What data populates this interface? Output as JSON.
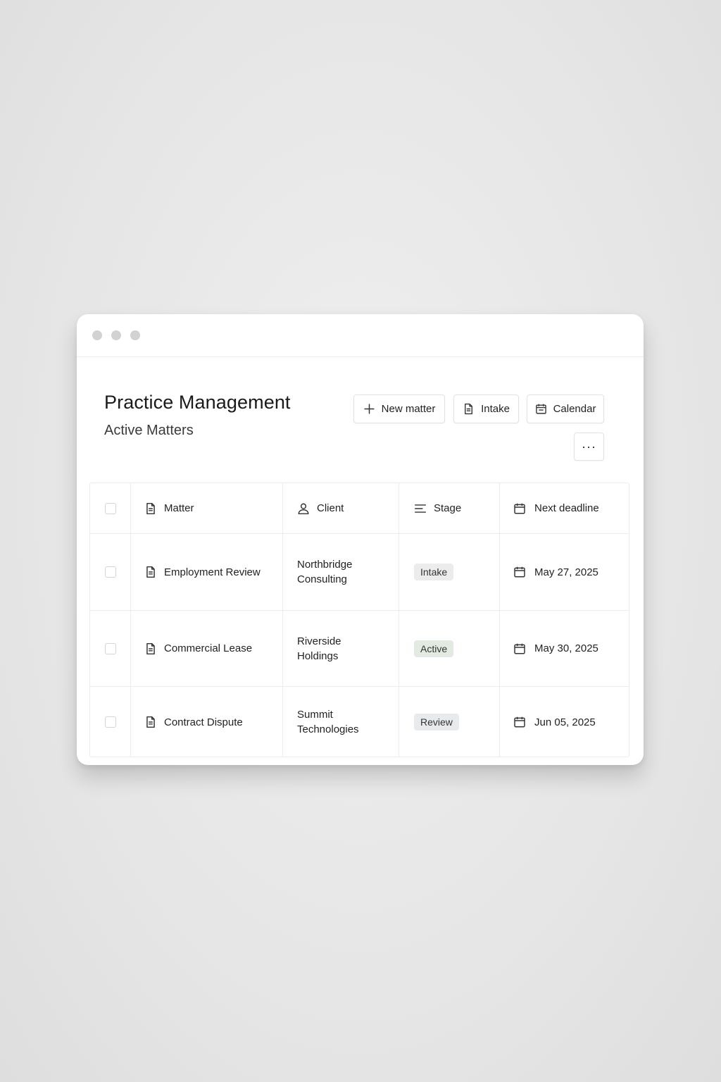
{
  "page": {
    "title": "Practice Management",
    "subtitle": "Active Matters"
  },
  "toolbar": {
    "new_matter_label": "New matter",
    "intake_label": "Intake",
    "calendar_label": "Calendar",
    "more_label": "···"
  },
  "table": {
    "headers": {
      "matter": "Matter",
      "client": "Client",
      "stage": "Stage",
      "deadline": "Next deadline"
    },
    "rows": [
      {
        "matter": "Employment Review",
        "client": "Northbridge\nConsulting",
        "stage": "Intake",
        "deadline": "May 27, 2025"
      },
      {
        "matter": "Commercial Lease",
        "client": "Riverside\nHoldings",
        "stage": "Active",
        "deadline": "May 30, 2025"
      },
      {
        "matter": "Contract Dispute",
        "client": "Summit\nTechnologies",
        "stage": "Review",
        "deadline": "Jun 05, 2025"
      }
    ]
  },
  "colors": {
    "stage_intake": "#ececec",
    "stage_active": "#e3ebe1",
    "stage_review": "#e8ebee"
  },
  "icons": {
    "new_matter": "plus-icon",
    "intake": "document-icon",
    "calendar": "calendar-icon",
    "more": "more-horizontal-icon",
    "matter": "document-icon",
    "client": "user-icon",
    "stage": "align-left-icon",
    "deadline": "calendar-icon"
  }
}
